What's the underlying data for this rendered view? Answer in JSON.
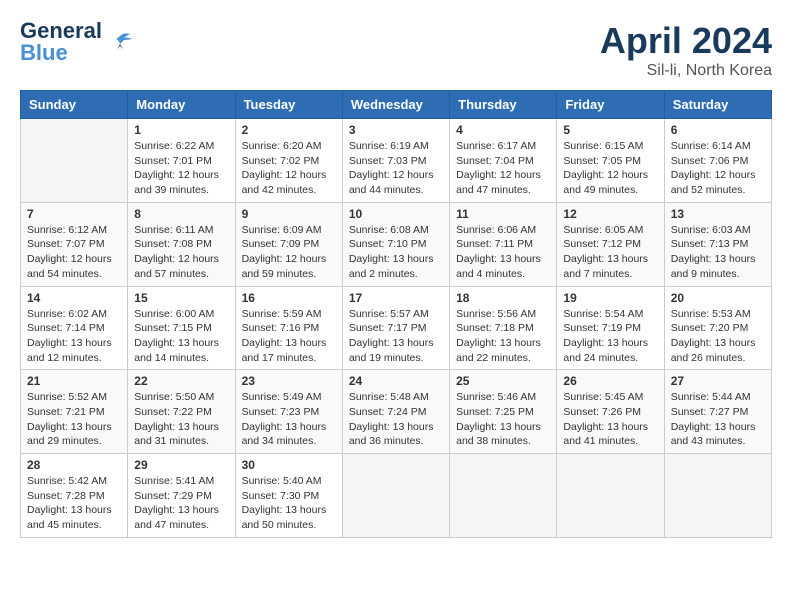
{
  "header": {
    "logo_line1": "General",
    "logo_line2": "Blue",
    "month_year": "April 2024",
    "location": "Sil-li, North Korea"
  },
  "weekdays": [
    "Sunday",
    "Monday",
    "Tuesday",
    "Wednesday",
    "Thursday",
    "Friday",
    "Saturday"
  ],
  "weeks": [
    [
      {
        "day": "",
        "info": ""
      },
      {
        "day": "1",
        "info": "Sunrise: 6:22 AM\nSunset: 7:01 PM\nDaylight: 12 hours\nand 39 minutes."
      },
      {
        "day": "2",
        "info": "Sunrise: 6:20 AM\nSunset: 7:02 PM\nDaylight: 12 hours\nand 42 minutes."
      },
      {
        "day": "3",
        "info": "Sunrise: 6:19 AM\nSunset: 7:03 PM\nDaylight: 12 hours\nand 44 minutes."
      },
      {
        "day": "4",
        "info": "Sunrise: 6:17 AM\nSunset: 7:04 PM\nDaylight: 12 hours\nand 47 minutes."
      },
      {
        "day": "5",
        "info": "Sunrise: 6:15 AM\nSunset: 7:05 PM\nDaylight: 12 hours\nand 49 minutes."
      },
      {
        "day": "6",
        "info": "Sunrise: 6:14 AM\nSunset: 7:06 PM\nDaylight: 12 hours\nand 52 minutes."
      }
    ],
    [
      {
        "day": "7",
        "info": "Sunrise: 6:12 AM\nSunset: 7:07 PM\nDaylight: 12 hours\nand 54 minutes."
      },
      {
        "day": "8",
        "info": "Sunrise: 6:11 AM\nSunset: 7:08 PM\nDaylight: 12 hours\nand 57 minutes."
      },
      {
        "day": "9",
        "info": "Sunrise: 6:09 AM\nSunset: 7:09 PM\nDaylight: 12 hours\nand 59 minutes."
      },
      {
        "day": "10",
        "info": "Sunrise: 6:08 AM\nSunset: 7:10 PM\nDaylight: 13 hours\nand 2 minutes."
      },
      {
        "day": "11",
        "info": "Sunrise: 6:06 AM\nSunset: 7:11 PM\nDaylight: 13 hours\nand 4 minutes."
      },
      {
        "day": "12",
        "info": "Sunrise: 6:05 AM\nSunset: 7:12 PM\nDaylight: 13 hours\nand 7 minutes."
      },
      {
        "day": "13",
        "info": "Sunrise: 6:03 AM\nSunset: 7:13 PM\nDaylight: 13 hours\nand 9 minutes."
      }
    ],
    [
      {
        "day": "14",
        "info": "Sunrise: 6:02 AM\nSunset: 7:14 PM\nDaylight: 13 hours\nand 12 minutes."
      },
      {
        "day": "15",
        "info": "Sunrise: 6:00 AM\nSunset: 7:15 PM\nDaylight: 13 hours\nand 14 minutes."
      },
      {
        "day": "16",
        "info": "Sunrise: 5:59 AM\nSunset: 7:16 PM\nDaylight: 13 hours\nand 17 minutes."
      },
      {
        "day": "17",
        "info": "Sunrise: 5:57 AM\nSunset: 7:17 PM\nDaylight: 13 hours\nand 19 minutes."
      },
      {
        "day": "18",
        "info": "Sunrise: 5:56 AM\nSunset: 7:18 PM\nDaylight: 13 hours\nand 22 minutes."
      },
      {
        "day": "19",
        "info": "Sunrise: 5:54 AM\nSunset: 7:19 PM\nDaylight: 13 hours\nand 24 minutes."
      },
      {
        "day": "20",
        "info": "Sunrise: 5:53 AM\nSunset: 7:20 PM\nDaylight: 13 hours\nand 26 minutes."
      }
    ],
    [
      {
        "day": "21",
        "info": "Sunrise: 5:52 AM\nSunset: 7:21 PM\nDaylight: 13 hours\nand 29 minutes."
      },
      {
        "day": "22",
        "info": "Sunrise: 5:50 AM\nSunset: 7:22 PM\nDaylight: 13 hours\nand 31 minutes."
      },
      {
        "day": "23",
        "info": "Sunrise: 5:49 AM\nSunset: 7:23 PM\nDaylight: 13 hours\nand 34 minutes."
      },
      {
        "day": "24",
        "info": "Sunrise: 5:48 AM\nSunset: 7:24 PM\nDaylight: 13 hours\nand 36 minutes."
      },
      {
        "day": "25",
        "info": "Sunrise: 5:46 AM\nSunset: 7:25 PM\nDaylight: 13 hours\nand 38 minutes."
      },
      {
        "day": "26",
        "info": "Sunrise: 5:45 AM\nSunset: 7:26 PM\nDaylight: 13 hours\nand 41 minutes."
      },
      {
        "day": "27",
        "info": "Sunrise: 5:44 AM\nSunset: 7:27 PM\nDaylight: 13 hours\nand 43 minutes."
      }
    ],
    [
      {
        "day": "28",
        "info": "Sunrise: 5:42 AM\nSunset: 7:28 PM\nDaylight: 13 hours\nand 45 minutes."
      },
      {
        "day": "29",
        "info": "Sunrise: 5:41 AM\nSunset: 7:29 PM\nDaylight: 13 hours\nand 47 minutes."
      },
      {
        "day": "30",
        "info": "Sunrise: 5:40 AM\nSunset: 7:30 PM\nDaylight: 13 hours\nand 50 minutes."
      },
      {
        "day": "",
        "info": ""
      },
      {
        "day": "",
        "info": ""
      },
      {
        "day": "",
        "info": ""
      },
      {
        "day": "",
        "info": ""
      }
    ]
  ]
}
